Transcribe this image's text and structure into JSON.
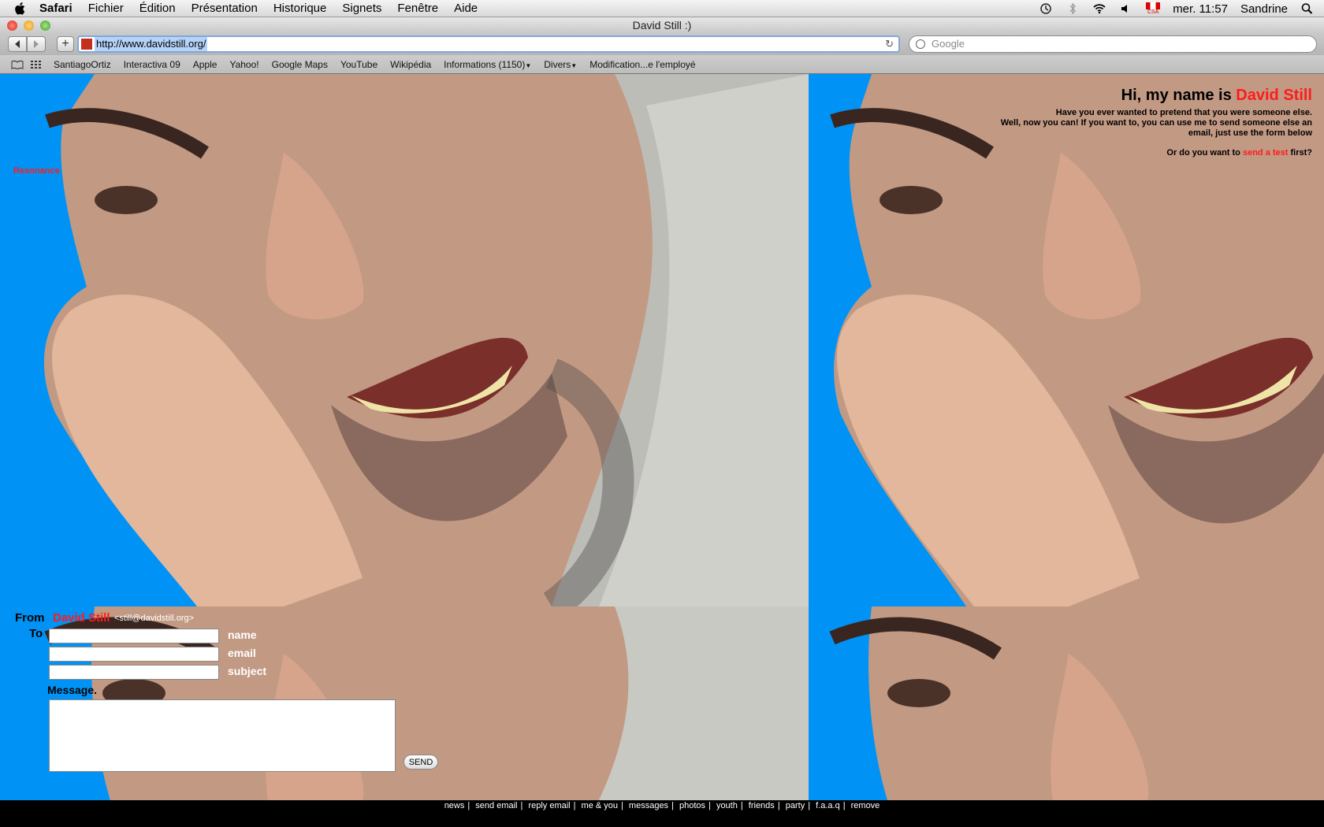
{
  "menubar": {
    "items": [
      "Safari",
      "Fichier",
      "Édition",
      "Présentation",
      "Historique",
      "Signets",
      "Fenêtre",
      "Aide"
    ],
    "clock": "mer. 11:57",
    "user": "Sandrine",
    "flag_label": "CSA"
  },
  "window": {
    "title": "David Still :)"
  },
  "toolbar": {
    "url": "http://www.davidstill.org/",
    "search_placeholder": "Google"
  },
  "bookmarks": [
    "SantiagoOrtiz",
    "Interactiva 09",
    "Apple",
    "Yahoo!",
    "Google Maps",
    "YouTube",
    "Wikipédia",
    "Informations (1150)",
    "Divers",
    "Modification...e l'employé"
  ],
  "page": {
    "resonance_link": "Resonance",
    "intro": {
      "hi_prefix": "Hi, my name is ",
      "hi_name": "David Still",
      "line1": "Have you ever wanted to pretend that you were someone else.",
      "line2": "Well, now you can! If you want to, you can use me to send someone else an email, just use the form below",
      "q_prefix": "Or do you want to ",
      "q_link": "send a test",
      "q_suffix": " first?"
    },
    "form": {
      "from_label": "From",
      "from_name": "David Still",
      "from_addr": "<still@davidstill.org>",
      "to_label": "To",
      "field_name": "name",
      "field_email": "email",
      "field_subject": "subject",
      "message_label": "Message.",
      "send": "SEND"
    },
    "footer_links": [
      "news",
      "send email",
      "reply email",
      "me & you",
      "messages",
      "photos",
      "youth",
      "friends",
      "party",
      "f.a.a.q",
      "remove"
    ]
  },
  "colors": {
    "page_bg": "#0093f5",
    "accent_red": "#ff1a1a",
    "footer_bg": "#000000"
  }
}
